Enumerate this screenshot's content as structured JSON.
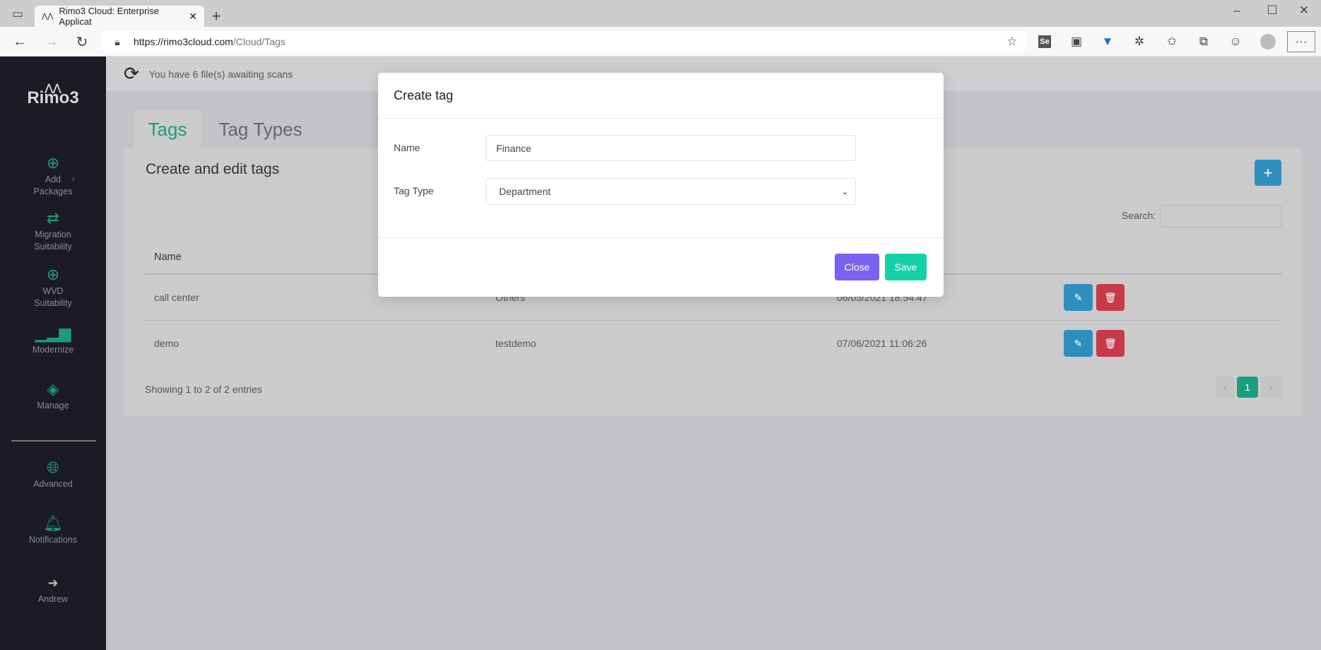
{
  "browser": {
    "tab_title": "Rimo3 Cloud: Enterprise Applicat",
    "url_host": "https://rimo3cloud.com",
    "url_path": "/Cloud/Tags",
    "more_label": "···"
  },
  "sidebar": {
    "logo": "Rimo3",
    "items": [
      {
        "label": "Add Packages",
        "icon": "plus-circle-icon"
      },
      {
        "label": "Migration Suitability",
        "icon": "arrows-exchange-icon"
      },
      {
        "label": "WVD Suitability",
        "icon": "zoom-in-icon"
      },
      {
        "label": "Modernize",
        "icon": "bar-chart-icon"
      },
      {
        "label": "Manage",
        "icon": "layers-icon"
      },
      {
        "label": "Advanced",
        "icon": "globe-icon"
      },
      {
        "label": "Notifications",
        "icon": "bell-icon"
      },
      {
        "label": "Andrew",
        "icon": "sign-out-icon"
      }
    ]
  },
  "notice": {
    "text": "You have 6 file(s) awaiting scans"
  },
  "tabs": [
    {
      "label": "Tags",
      "active": true
    },
    {
      "label": "Tag Types",
      "active": false
    }
  ],
  "card": {
    "title": "Create and edit tags",
    "search_label": "Search:",
    "search_value": "",
    "columns": [
      "Name"
    ],
    "rows": [
      {
        "name": "call center",
        "type": "Others",
        "date": "06/05/2021 18:54:47"
      },
      {
        "name": "demo",
        "type": "testdemo",
        "date": "07/06/2021 11:06:26"
      }
    ],
    "footer": "Showing 1 to 2 of 2 entries",
    "pagination": {
      "prev": "‹",
      "current": "1",
      "next": "›"
    }
  },
  "modal": {
    "title": "Create tag",
    "name_label": "Name",
    "name_value": "Finance",
    "type_label": "Tag Type",
    "type_value": "Department",
    "close_label": "Close",
    "save_label": "Save"
  },
  "colors": {
    "accent": "#1fa587",
    "sidebar": "#1a1b23",
    "close": "#7b61f0",
    "save": "#14d1a6",
    "edit": "#2e8fbe",
    "delete": "#c63a4a"
  }
}
